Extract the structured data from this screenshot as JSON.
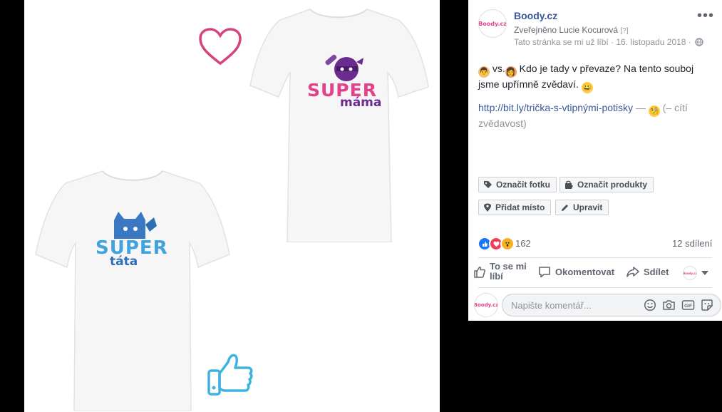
{
  "post": {
    "page_name": "Boody.cz",
    "logo_text": "Boody.cz",
    "byline_prefix": "Zveřejněno",
    "author": "Lucie Kocurová",
    "help_mark": "[?]",
    "meta": "Tato stránka se mi už líbí · 16. listopadu 2018 ·",
    "text_a": " vs.",
    "text_b": " Kdo je tady v převaze? Na tento souboj jsme upřímně zvědaví. ",
    "link": "http://bit.ly/trička-s-vtipnými-potisky",
    "feeling_prefix": " — ",
    "feeling": " (– cítí zvědavost)"
  },
  "photo": {
    "shirt_female": {
      "word1": "SUPER",
      "word2": "máma",
      "color1": "#e4418b",
      "color2": "#6a2c8e"
    },
    "shirt_male": {
      "word1": "SUPER",
      "word2": "táta",
      "color1": "#3fa3e0",
      "color2": "#2f6db3"
    },
    "heart_color": "#d6427e",
    "thumb_color": "#3fb3e0"
  },
  "tag_buttons": {
    "tag_photo": "Označit fotku",
    "tag_products": "Označit produkty",
    "add_location": "Přidat místo",
    "edit": "Upravit"
  },
  "stats": {
    "reaction_count": "162",
    "shares": "12 sdílení"
  },
  "actions": {
    "like": "To se mi líbí",
    "comment": "Okomentovat",
    "share": "Sdílet"
  },
  "comment": {
    "placeholder": "Napište komentář..."
  },
  "colors": {
    "link": "#365899",
    "muted": "#90949c",
    "like_blue": "#1877f2",
    "love_red": "#f33e58",
    "wow_yellow": "#f7b125"
  }
}
